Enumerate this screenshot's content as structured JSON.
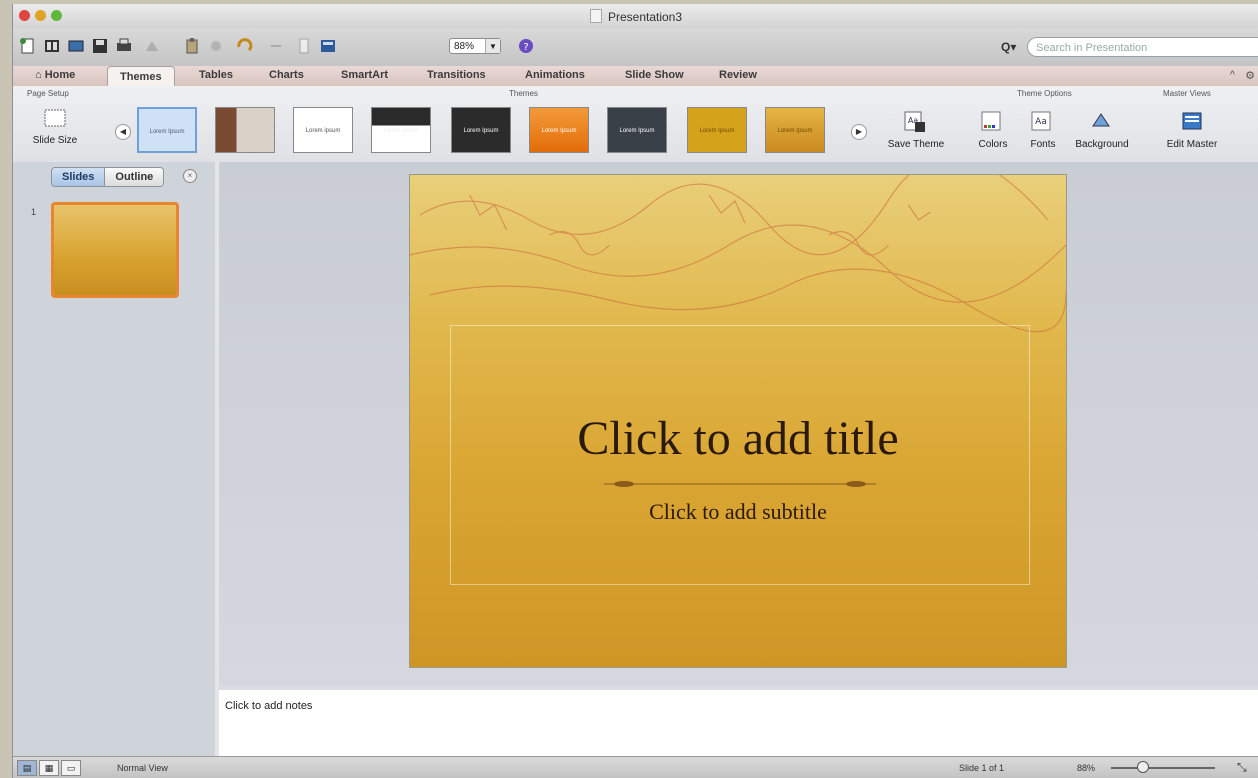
{
  "window": {
    "title": "Presentation3"
  },
  "toolbar": {
    "zoom": "88%",
    "search_placeholder": "Search in Presentation",
    "icons": [
      "new-icon",
      "templates-icon",
      "open-icon",
      "save-icon",
      "print-icon",
      "paste-icon",
      "copy-icon",
      "undo-icon",
      "redo-icon",
      "insert-icon",
      "zoom-icon",
      "help-icon"
    ]
  },
  "tabs": [
    {
      "label": "Home",
      "active": false
    },
    {
      "label": "Themes",
      "active": true
    },
    {
      "label": "Tables",
      "active": false
    },
    {
      "label": "Charts",
      "active": false
    },
    {
      "label": "SmartArt",
      "active": false
    },
    {
      "label": "Transitions",
      "active": false
    },
    {
      "label": "Animations",
      "active": false
    },
    {
      "label": "Slide Show",
      "active": false
    },
    {
      "label": "Review",
      "active": false
    }
  ],
  "ribbon": {
    "page_setup_group": "Page Setup",
    "slide_size": "Slide Size",
    "themes_group": "Themes",
    "theme_thumbs": [
      {
        "label": "Lorem Ipsum",
        "color": "#cfe2f5"
      },
      {
        "label": "",
        "color": "#7a4a33"
      },
      {
        "label": "Lorem ipsum",
        "color": "#ffffff"
      },
      {
        "label": "Lorem Ipsum",
        "color": "#2a2a2a"
      },
      {
        "label": "Lorem Ipsum",
        "color": "#2b2b2b"
      },
      {
        "label": "Lorem Ipsum",
        "color": "#e97a12"
      },
      {
        "label": "Lorem Ipsum",
        "color": "#3a4048"
      },
      {
        "label": "Lorem Ipsum",
        "color": "#d5a31b"
      },
      {
        "label": "Lorem Ipsum",
        "color": "#d79a2a"
      }
    ],
    "save_theme": "Save Theme",
    "theme_options_group": "Theme Options",
    "colors": "Colors",
    "fonts": "Fonts",
    "background": "Background",
    "master_views_group": "Master Views",
    "edit_master": "Edit Master"
  },
  "sidebar": {
    "tab_slides": "Slides",
    "tab_outline": "Outline",
    "slide_number": "1"
  },
  "slide": {
    "title": "Click to add title",
    "subtitle": "Click to add subtitle"
  },
  "notes": {
    "placeholder": "Click to add notes"
  },
  "statusbar": {
    "view_label": "Normal View",
    "slide_count": "Slide 1 of 1",
    "zoom": "88%"
  }
}
